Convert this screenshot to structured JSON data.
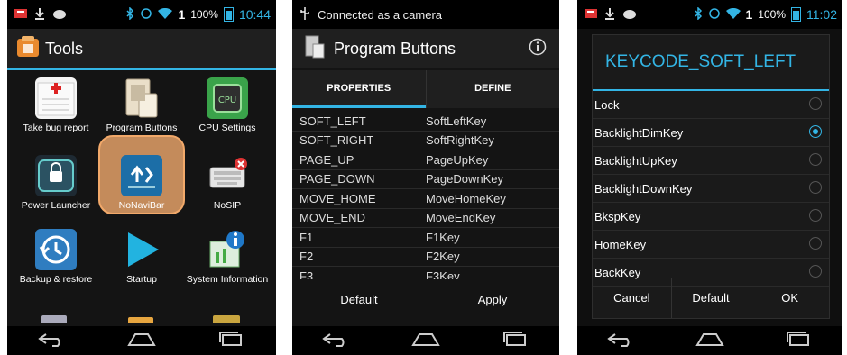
{
  "screen1": {
    "status": {
      "signal": "1",
      "battery": "100%",
      "time": "10:44"
    },
    "title": "Tools",
    "apps": [
      {
        "label": "Take bug report"
      },
      {
        "label": "Program Buttons"
      },
      {
        "label": "CPU Settings"
      },
      {
        "label": "Power Launcher"
      },
      {
        "label": "NoNaviBar"
      },
      {
        "label": "NoSIP"
      },
      {
        "label": "Backup & restore"
      },
      {
        "label": "Startup"
      },
      {
        "label": "System Information"
      }
    ]
  },
  "screen2": {
    "status_text": "Connected as a camera",
    "title": "Program Buttons",
    "tabs": [
      "PROPERTIES",
      "DEFINE"
    ],
    "rows": [
      {
        "key": "SOFT_LEFT",
        "value": "SoftLeftKey"
      },
      {
        "key": "SOFT_RIGHT",
        "value": "SoftRightKey"
      },
      {
        "key": "PAGE_UP",
        "value": "PageUpKey"
      },
      {
        "key": "PAGE_DOWN",
        "value": "PageDownKey"
      },
      {
        "key": "MOVE_HOME",
        "value": "MoveHomeKey"
      },
      {
        "key": "MOVE_END",
        "value": "MoveEndKey"
      },
      {
        "key": "F1",
        "value": "F1Key"
      },
      {
        "key": "F2",
        "value": "F2Key"
      },
      {
        "key": "F3",
        "value": "F3Key"
      }
    ],
    "buttons": {
      "default": "Default",
      "apply": "Apply"
    }
  },
  "screen3": {
    "status": {
      "signal": "1",
      "battery": "100%",
      "time": "11:02"
    },
    "dialog_title": "KEYCODE_SOFT_LEFT",
    "options": [
      {
        "label": "Lock",
        "selected": false
      },
      {
        "label": "BacklightDimKey",
        "selected": true
      },
      {
        "label": "BacklightUpKey",
        "selected": false
      },
      {
        "label": "BacklightDownKey",
        "selected": false
      },
      {
        "label": "BkspKey",
        "selected": false
      },
      {
        "label": "HomeKey",
        "selected": false
      },
      {
        "label": "BackKey",
        "selected": false
      }
    ],
    "buttons": {
      "cancel": "Cancel",
      "default": "Default",
      "ok": "OK"
    }
  },
  "colors": {
    "accent": "#33b5e5",
    "highlight": "#c48b5b",
    "background": "#141414"
  },
  "icons": [
    "back-icon",
    "home-icon",
    "recents-icon",
    "info-icon",
    "wifi-icon",
    "bluetooth-icon",
    "battery-icon"
  ]
}
